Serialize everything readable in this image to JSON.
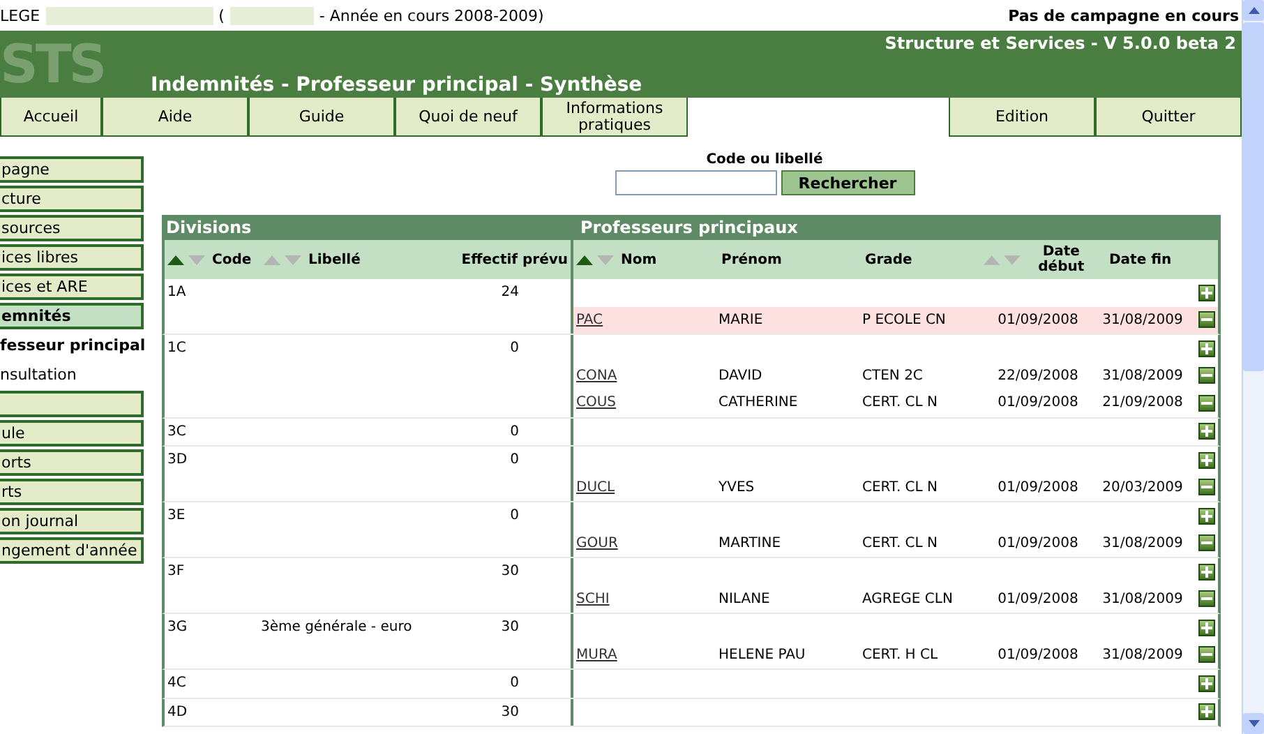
{
  "top_bar": {
    "school_prefix": "LEGE",
    "open_paren": "(",
    "year_text": "- Année en cours 2008-2009)",
    "campaign_status": "Pas de campagne en cours"
  },
  "banner": {
    "logo": "STS",
    "app_name": "Structure et Services - V 5.0.0 beta 2",
    "page_title": "Indemnités - Professeur principal - Synthèse"
  },
  "nav_left": [
    {
      "label": "Accueil"
    },
    {
      "label": "Aide"
    },
    {
      "label": "Guide"
    },
    {
      "label": "Quoi de neuf"
    },
    {
      "label": "Informations pratiques"
    }
  ],
  "nav_right": [
    {
      "label": "Edition"
    },
    {
      "label": "Quitter"
    }
  ],
  "sidebar": {
    "items": [
      {
        "kind": "menu",
        "label": "pagne",
        "selected": false
      },
      {
        "kind": "menu",
        "label": "cture",
        "selected": false
      },
      {
        "kind": "menu",
        "label": "sources",
        "selected": false
      },
      {
        "kind": "menu",
        "label": "ices libres",
        "selected": false
      },
      {
        "kind": "menu",
        "label": "ices et ARE",
        "selected": false
      },
      {
        "kind": "menu",
        "label": "emnités",
        "selected": true
      },
      {
        "kind": "sub",
        "label": "fesseur principal",
        "selected": true
      },
      {
        "kind": "sub",
        "label": "nsultation",
        "selected": false
      },
      {
        "kind": "menu",
        "selected": false
      },
      {
        "kind": "menu",
        "label": "ule",
        "selected": false
      },
      {
        "kind": "menu",
        "label": "orts",
        "selected": false
      },
      {
        "kind": "menu",
        "label": "rts",
        "selected": false
      },
      {
        "kind": "menu",
        "label": "on journal",
        "selected": false
      },
      {
        "kind": "menu",
        "label": "ngement d'année",
        "selected": false
      }
    ]
  },
  "search": {
    "label": "Code ou libellé",
    "button": "Rechercher"
  },
  "divisions": {
    "title": "Divisions",
    "columns": [
      {
        "label": "Code",
        "sorted": true
      },
      {
        "label": "Libellé",
        "sorted": false
      },
      {
        "label": "Effectif prévu"
      }
    ]
  },
  "professeurs": {
    "title": "Professeurs principaux",
    "columns": [
      {
        "label": "Nom",
        "sorted": true
      },
      {
        "label": "Prénom"
      },
      {
        "label": "Grade"
      },
      {
        "label": "Date début",
        "sorted": false
      },
      {
        "label": "Date fin"
      }
    ]
  },
  "rows": [
    {
      "code": "1A",
      "effectif": "24",
      "lines": [
        {
          "kind": "add"
        },
        {
          "kind": "teacher",
          "nom": "PAC",
          "prenom": "MARIE",
          "grade": "P ECOLE CN",
          "debut": "01/09/2008",
          "fin": "31/08/2009",
          "highlighted": true
        }
      ]
    },
    {
      "code": "1C",
      "effectif": "0",
      "lines": [
        {
          "kind": "add"
        },
        {
          "kind": "teacher",
          "nom": "CONA",
          "prenom": "DAVID",
          "grade": "CTEN 2C",
          "debut": "22/09/2008",
          "fin": "31/08/2009",
          "highlighted": false
        },
        {
          "kind": "teacher",
          "nom": "COUS",
          "prenom": "CATHERINE",
          "grade": "CERT. CL N",
          "debut": "01/09/2008",
          "fin": "21/09/2008",
          "highlighted": false
        }
      ]
    },
    {
      "code": "3C",
      "effectif": "0",
      "lines": [
        {
          "kind": "add"
        }
      ]
    },
    {
      "code": "3D",
      "effectif": "0",
      "lines": [
        {
          "kind": "add"
        },
        {
          "kind": "teacher",
          "nom": "DUCL",
          "prenom": "YVES",
          "grade": "CERT. CL N",
          "debut": "01/09/2008",
          "fin": "20/03/2009",
          "highlighted": false
        }
      ]
    },
    {
      "code": "3E",
      "effectif": "0",
      "lines": [
        {
          "kind": "add"
        },
        {
          "kind": "teacher",
          "nom": "GOUR",
          "prenom": "MARTINE",
          "grade": "CERT. CL N",
          "debut": "01/09/2008",
          "fin": "31/08/2009",
          "highlighted": false
        }
      ]
    },
    {
      "code": "3F",
      "effectif": "30",
      "lines": [
        {
          "kind": "add"
        },
        {
          "kind": "teacher",
          "nom": "SCHI",
          "prenom": "NILANE",
          "grade": "AGREGE CLN",
          "debut": "01/09/2008",
          "fin": "31/08/2009",
          "highlighted": false
        }
      ]
    },
    {
      "code": "3G",
      "libelle": "3ème générale - euro",
      "effectif": "30",
      "lines": [
        {
          "kind": "add"
        },
        {
          "kind": "teacher",
          "nom": "MURA",
          "prenom": "HELENE PAU",
          "grade": "CERT. H CL",
          "debut": "01/09/2008",
          "fin": "31/08/2009",
          "highlighted": false
        }
      ]
    },
    {
      "code": "4C",
      "effectif": "0",
      "lines": [
        {
          "kind": "add"
        }
      ]
    },
    {
      "code": "4D",
      "effectif": "30",
      "lines": [
        {
          "kind": "add"
        }
      ]
    }
  ]
}
